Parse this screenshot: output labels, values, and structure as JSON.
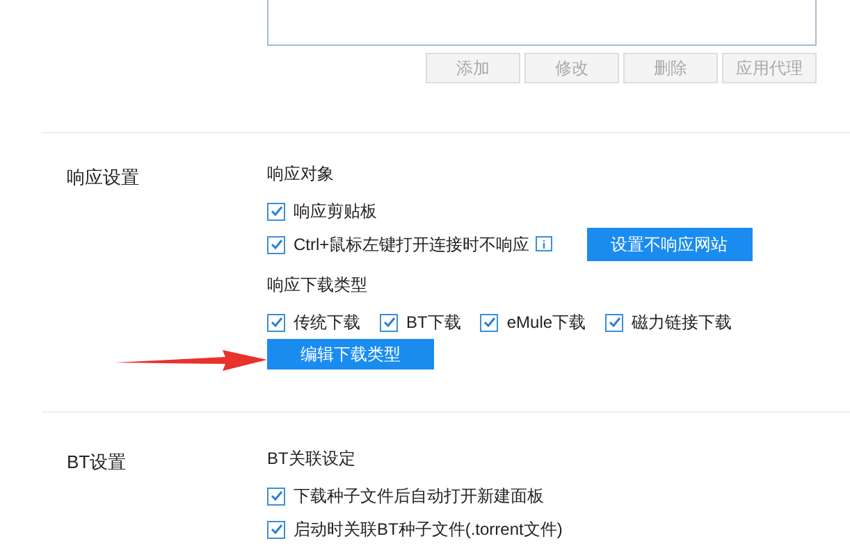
{
  "proxy_buttons": [
    {
      "label": "添加",
      "disabled": true
    },
    {
      "label": "修改",
      "disabled": true
    },
    {
      "label": "删除",
      "disabled": true
    },
    {
      "label": "应用代理",
      "disabled": true
    }
  ],
  "response_settings": {
    "title": "响应设置",
    "target_heading": "响应对象",
    "target_options": [
      {
        "label": "响应剪贴板",
        "checked": true
      },
      {
        "label": "Ctrl+鼠标左键打开连接时不响应",
        "checked": true
      }
    ],
    "no_response_button": "设置不响应网站",
    "type_heading": "响应下载类型",
    "type_options": [
      {
        "label": "传统下载",
        "checked": true
      },
      {
        "label": "BT下载",
        "checked": true
      },
      {
        "label": "eMule下载",
        "checked": true
      },
      {
        "label": "磁力链接下载",
        "checked": true
      }
    ],
    "edit_types_button": "编辑下载类型"
  },
  "bt_settings": {
    "title": "BT设置",
    "heading": "BT关联设定",
    "options": [
      {
        "label": "下载种子文件后自动打开新建面板",
        "checked": true
      },
      {
        "label": "启动时关联BT种子文件(.torrent文件)",
        "checked": true
      }
    ]
  }
}
